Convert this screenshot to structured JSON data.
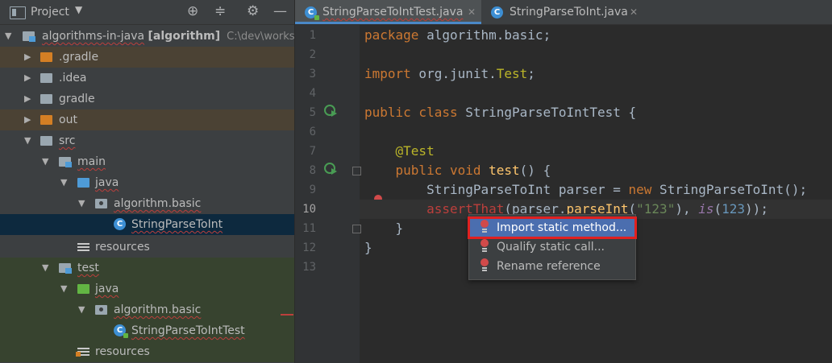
{
  "project_panel": {
    "title": "Project",
    "tree": [
      {
        "label": "algorithms-in-java",
        "module": "[algorithm]",
        "path": "C:\\dev\\works"
      },
      {
        "label": ".gradle"
      },
      {
        "label": ".idea"
      },
      {
        "label": "gradle"
      },
      {
        "label": "out"
      },
      {
        "label": "src"
      },
      {
        "label": "main"
      },
      {
        "label": "java"
      },
      {
        "label": "algorithm.basic"
      },
      {
        "label": "StringParseToInt"
      },
      {
        "label": "resources"
      },
      {
        "label": "test"
      },
      {
        "label": "java"
      },
      {
        "label": "algorithm.basic"
      },
      {
        "label": "StringParseToIntTest"
      },
      {
        "label": "resources"
      }
    ]
  },
  "editor": {
    "tabs": [
      {
        "label": "StringParseToIntTest.java",
        "active": true
      },
      {
        "label": "StringParseToInt.java",
        "active": false
      }
    ],
    "line_numbers": [
      "1",
      "2",
      "3",
      "4",
      "5",
      "6",
      "7",
      "8",
      "9",
      "10",
      "11",
      "12",
      "13"
    ],
    "code": {
      "l1_kw": "package",
      "l1_rest": " algorithm.basic;",
      "l3_kw": "import",
      "l3_rest": " org.junit.",
      "l3_cls": "Test",
      "l3_end": ";",
      "l5_kw": "public class",
      "l5_rest": " StringParseToIntTest {",
      "l7_ann": "@Test",
      "l8_kw": "public void",
      "l8_sp": " ",
      "l8_fn": "test",
      "l8_rest": "() {",
      "l9_a": "StringParseToInt parser = ",
      "l9_kw": "new",
      "l9_b": " StringParseToInt();",
      "l10_err": "assertThat",
      "l10_a": "(parser.",
      "l10_m": "parseInt",
      "l10_b": "(",
      "l10_str": "\"123\"",
      "l10_c": "), ",
      "l10_is": "is",
      "l10_d": "(",
      "l10_num": "123",
      "l10_e": "));",
      "l11": "}",
      "l12": "}"
    }
  },
  "popup": {
    "items": [
      {
        "label": "Import static method...",
        "selected": true
      },
      {
        "label": "Qualify static call..."
      },
      {
        "label": "Rename reference"
      }
    ]
  },
  "colors": {
    "selection": "#4b6eaf",
    "highlight_box": "#e02020",
    "error": "#bc3f3c",
    "keyword": "#cc7832"
  }
}
